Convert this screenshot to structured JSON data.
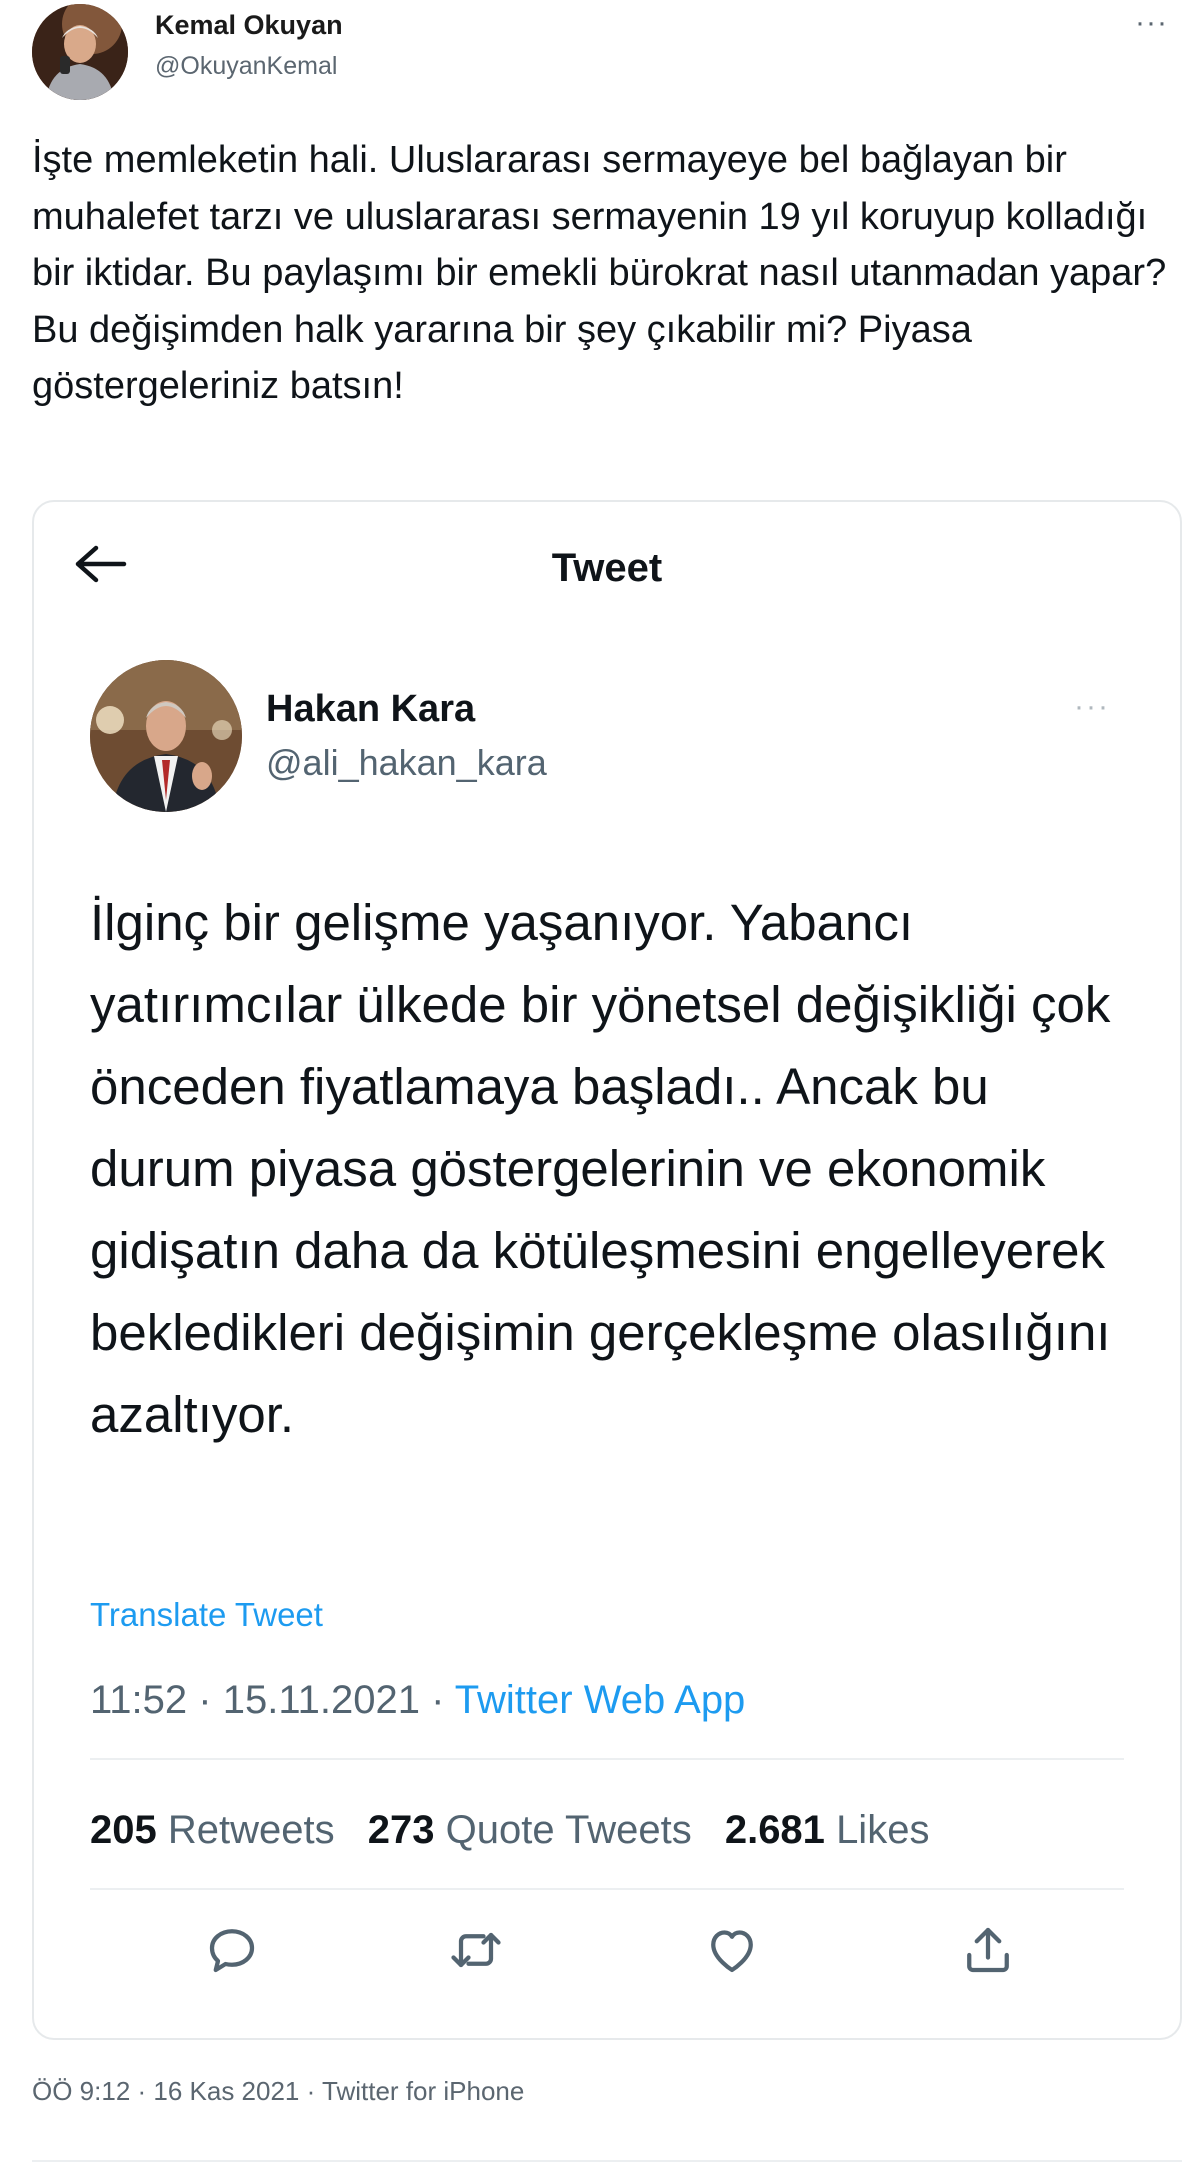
{
  "outer_tweet": {
    "author_name": "Kemal Okuyan",
    "author_handle": "@OkuyanKemal",
    "text": "İşte memleketin hali. Uluslararası sermayeye bel bağlayan bir muhalefet tarzı ve uluslararası sermayenin 19 yıl koruyup kolladığı bir iktidar. Bu paylaşımı bir emekli bürokrat nasıl utanmadan yapar? Bu değişimden halk yararına bir şey çıkabilir mi? Piyasa göstergeleriniz batsın!",
    "more_label": "···",
    "footer_meta": "ÖÖ 9:12 · 16 Kas 2021 · Twitter for iPhone"
  },
  "quoted_screenshot": {
    "header_title": "Tweet",
    "author_name": "Hakan Kara",
    "author_handle": "@ali_hakan_kara",
    "more_label": "···",
    "text": "İlginç bir gelişme yaşanıyor. Yabancı yatırımcılar ülkede bir yönetsel değişikliği çok önceden fiyatlamaya başladı.. Ancak bu durum piyasa göstergelerinin ve ekonomik gidişatın daha da kötüleşmesini engelleyerek bekledikleri değişimin gerçekleşme olasılığını azaltıyor.",
    "translate_label": "Translate Tweet",
    "time": "11:52",
    "date": "15.11.2021",
    "separator": "·",
    "app": "Twitter Web App",
    "stats": {
      "retweets_count": "205",
      "retweets_label": "Retweets",
      "quotes_count": "273",
      "quotes_label": "Quote Tweets",
      "likes_count": "2.681",
      "likes_label": "Likes"
    },
    "actions": [
      "reply-icon",
      "retweet-icon",
      "like-icon",
      "share-icon"
    ]
  },
  "colors": {
    "link": "#1d9bf0",
    "secondary_text": "#536471",
    "primary_text": "#0f1419",
    "border": "#e6e9eb"
  }
}
